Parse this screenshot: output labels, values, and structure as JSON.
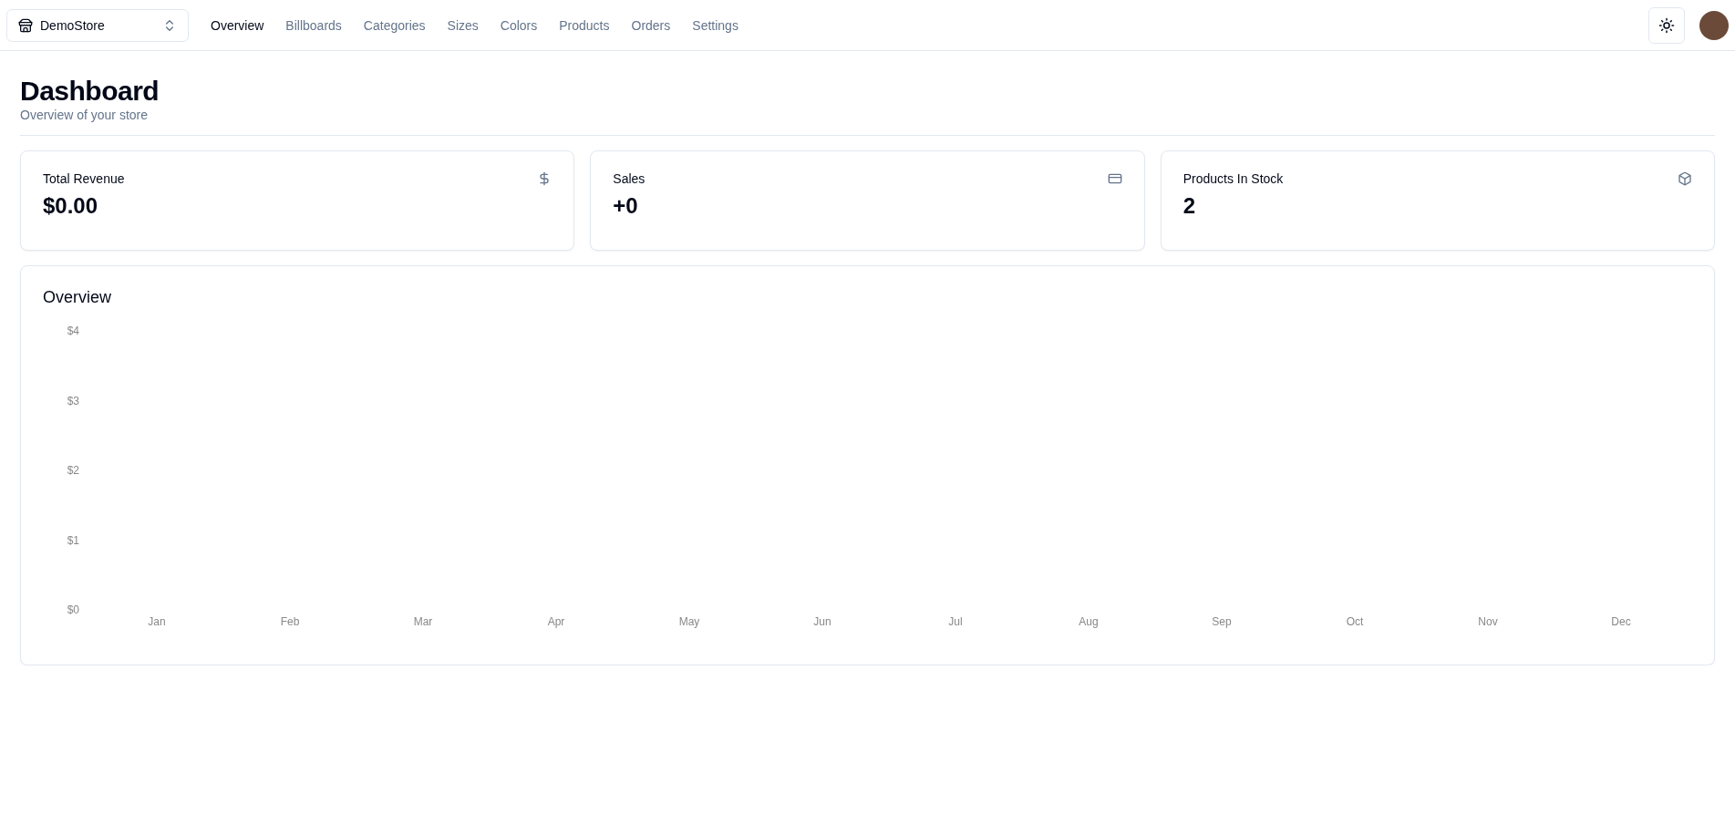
{
  "navbar": {
    "store_switcher": {
      "label": "DemoStore"
    },
    "links": [
      {
        "label": "Overview",
        "selected": true
      },
      {
        "label": "Billboards",
        "selected": false
      },
      {
        "label": "Categories",
        "selected": false
      },
      {
        "label": "Sizes",
        "selected": false
      },
      {
        "label": "Colors",
        "selected": false
      },
      {
        "label": "Products",
        "selected": false
      },
      {
        "label": "Orders",
        "selected": false
      },
      {
        "label": "Settings",
        "selected": false
      }
    ]
  },
  "heading": {
    "title": "Dashboard",
    "subtitle": "Overview of your store"
  },
  "stats": [
    {
      "kind": "revenue",
      "title": "Total Revenue",
      "value": "$0.00"
    },
    {
      "kind": "sales",
      "title": "Sales",
      "value": "+0"
    },
    {
      "kind": "stock",
      "title": "Products In Stock",
      "value": "2"
    }
  ],
  "overview": {
    "title": "Overview",
    "chart_data": {
      "type": "bar",
      "categories": [
        "Jan",
        "Feb",
        "Mar",
        "Apr",
        "May",
        "Jun",
        "Jul",
        "Aug",
        "Sep",
        "Oct",
        "Nov",
        "Dec"
      ],
      "values": [
        0,
        0,
        0,
        0,
        0,
        0,
        0,
        0,
        0,
        0,
        0,
        0
      ],
      "ylim": [
        0,
        4
      ],
      "yticks": [
        {
          "value": 0,
          "label": "$0"
        },
        {
          "value": 1,
          "label": "$1"
        },
        {
          "value": 2,
          "label": "$2"
        },
        {
          "value": 3,
          "label": "$3"
        },
        {
          "value": 4,
          "label": "$4"
        }
      ]
    }
  }
}
